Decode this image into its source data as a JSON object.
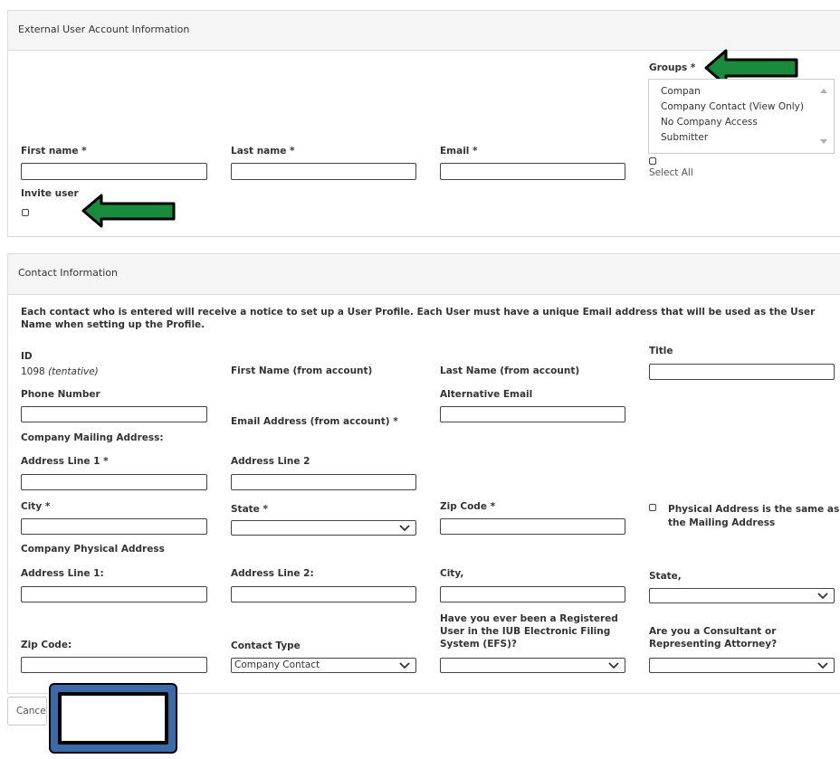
{
  "account_section": {
    "title": "External User Account Information",
    "first_name_label": "First name *",
    "last_name_label": "Last name *",
    "email_label": "Email *",
    "groups_label": "Groups *",
    "groups_options": [
      "Compan",
      "Company Contact (View Only)",
      "No Company Access",
      "Submitter"
    ],
    "select_all_label": "Select All",
    "invite_user_label": "Invite user"
  },
  "contact_section": {
    "title": "Contact Information",
    "notice": "Each contact who is entered will receive a notice to set up a User Profile. Each User must have a unique Email address that will be used as the User Name when setting up the Profile.",
    "id_label": "ID",
    "id_value": "1098",
    "id_note": "(tentative)",
    "first_name_label": "First Name (from account)",
    "last_name_label": "Last Name (from account)",
    "title_label": "Title",
    "phone_label": "Phone Number",
    "email_label": "Email Address (from account) *",
    "alt_email_label": "Alternative Email",
    "mailing_address_heading": "Company Mailing Address:",
    "mail_addr1_label": "Address Line 1 *",
    "mail_addr2_label": "Address Line 2",
    "city_label": "City *",
    "state_label": "State *",
    "zip_label": "Zip Code *",
    "physical_same_label_1": "Physical Address is the same as",
    "physical_same_label_2": "the Mailing Address",
    "physical_address_heading": "Company Physical Address",
    "phys_addr1_label": "Address Line 1:",
    "phys_addr2_label": "Address Line 2:",
    "phys_city_label": "City,",
    "phys_state_label": "State,",
    "phys_zip_label": "Zip Code:",
    "contact_type_label": "Contact Type",
    "contact_type_value": "Company Contact",
    "efs_label_1": "Have you ever been a Registered",
    "efs_label_2": "User in the IUB Electronic Filing",
    "efs_label_3": "System (EFS)?",
    "consultant_label_1": "Are you a Consultant or",
    "consultant_label_2": "Representing Attorney?"
  },
  "footer": {
    "cancel_label": "Cance"
  },
  "colors": {
    "arrow_green": "#1a8a3c",
    "highlight_box": "#3b6aa8"
  }
}
